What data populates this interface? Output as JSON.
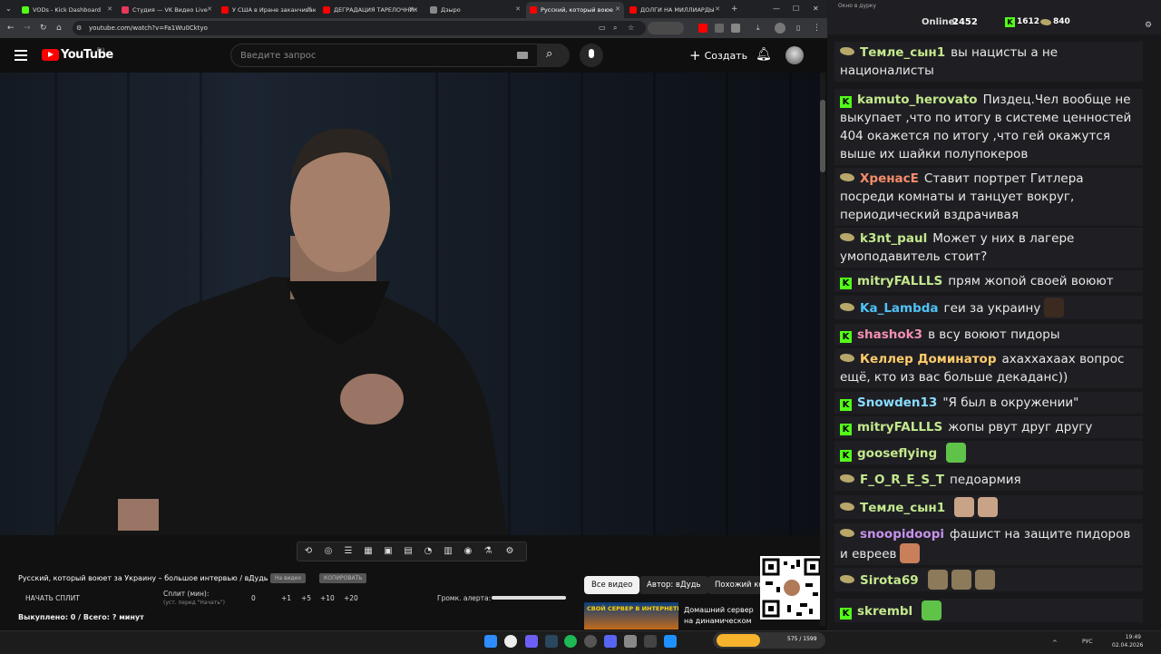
{
  "browser": {
    "tabs": [
      {
        "label": "VODs - Kick Dashboard",
        "color": "#53fc18"
      },
      {
        "label": "Студия — VK Видео Live",
        "color": "#e8385a"
      },
      {
        "label": "У США в Иране заканчиваю",
        "color": "#ff0000"
      },
      {
        "label": "ДЕГРАДАЦИЯ ТАРЕЛОЧНИК",
        "color": "#ff0000"
      },
      {
        "label": "Дзыро",
        "color": "#888888"
      },
      {
        "label": "Русский, который воюе",
        "color": "#ff0000",
        "active": true
      },
      {
        "label": "ДОЛГИ НА МИЛЛИАРДЫ",
        "color": "#ff0000"
      }
    ],
    "url": "youtube.com/watch?v=Fa1Wu0Cktyo"
  },
  "youtube": {
    "logo": "YouTube",
    "region": "RU",
    "search_placeholder": "Введите запрос",
    "create_label": "Создать"
  },
  "panel": {
    "video_title": "Русский, который воюет за Украину – большое интервью / вДудь",
    "btn_on_video": "На видео",
    "btn_copy": "КОПИРОВАТЬ",
    "split_start": "НАЧАТЬ СПЛИТ",
    "split_label": "Сплит (мин):",
    "split_hint": "(уст. перед \"Начать\")",
    "split_values": [
      "0",
      "+1",
      "+5",
      "+10",
      "+20"
    ],
    "alert_label": "Громк. алерта:",
    "alert_level": 1.0,
    "bought": "Выкуплено: 0 / Всего: ? минут",
    "filters": [
      "Все видео",
      "Автор: вДудь",
      "Похожий ко"
    ],
    "rec_thumb_text": "СВОЙ СЕРВЕР В ИНТЕРНЕТЕ!",
    "rec_title": "Домашний сервер на динамическом IP бесплатно!..."
  },
  "chat": {
    "window_title": "Окно в дурку",
    "online_label": "Online:",
    "online_count": "2452",
    "kick_count": "1612",
    "other_count": "840",
    "colors": {
      "kick": "#53fc18",
      "accent": "#b8a76a"
    },
    "messages": [
      {
        "badge": "p",
        "nick": "Темле_сын1",
        "color": "#c3e88d",
        "text": "вы нацисты а не националисты"
      },
      {
        "badge": "k",
        "nick": "kamuto_herovato",
        "color": "#c3e88d",
        "text": "Пиздец.Чел вообще не выкупает ,что по итогу в системе ценностей 404 окажется по итогу ,что гей окажутся выше их шайки полупокеров"
      },
      {
        "badge": "p",
        "nick": "ХренасЕ",
        "color": "#f78c6c",
        "text": "Ставит портрет Гитлера посреди комнаты и танцует вокруг, периодический вздрачивая"
      },
      {
        "badge": "p",
        "nick": "k3nt_paul",
        "color": "#c3e88d",
        "text": "Может у них в лагере умоподавитель стоит?"
      },
      {
        "badge": "k",
        "nick": "mitryFALLLS",
        "color": "#c3e88d",
        "text": "прям жопой своей воюют"
      },
      {
        "badge": "p",
        "nick": "Ka_Lambda",
        "color": "#4fc3f7",
        "text": "геи за украину"
      },
      {
        "badge": "k",
        "nick": "shashok3",
        "color": "#f48fb1",
        "text": "в всу воюют пидоры"
      },
      {
        "badge": "p",
        "nick": "Келлер Доминатор",
        "color": "#ffcb6b",
        "text": "ахаххахаах вопрос ещё, кто из вас больше декаданс))"
      },
      {
        "badge": "k",
        "nick": "Snowden13",
        "color": "#89ddff",
        "text": "\"Я был в окружении\""
      },
      {
        "badge": "k",
        "nick": "mitryFALLLS",
        "color": "#c3e88d",
        "text": "жопы рвут друг другу"
      },
      {
        "badge": "k",
        "nick": "gooseflying",
        "color": "#c3e88d",
        "text": ""
      },
      {
        "badge": "p",
        "nick": "F_O_R_E_S_T",
        "color": "#c3e88d",
        "text": "педоармия"
      },
      {
        "badge": "p",
        "nick": "Темле_сын1",
        "color": "#c3e88d",
        "text": ""
      },
      {
        "badge": "p",
        "nick": "snoopidoopi",
        "color": "#c792ea",
        "text": "фашист на защите пидоров и евреев"
      },
      {
        "badge": "p",
        "nick": "Sirota69",
        "color": "#c3e88d",
        "text": ""
      },
      {
        "badge": "k",
        "nick": "skrembl",
        "color": "#c3e88d",
        "text": ""
      }
    ]
  },
  "taskbar": {
    "lang": "РУС",
    "time": "19:49",
    "date": "02.04.2026",
    "widget_text": "575 / 1599"
  }
}
